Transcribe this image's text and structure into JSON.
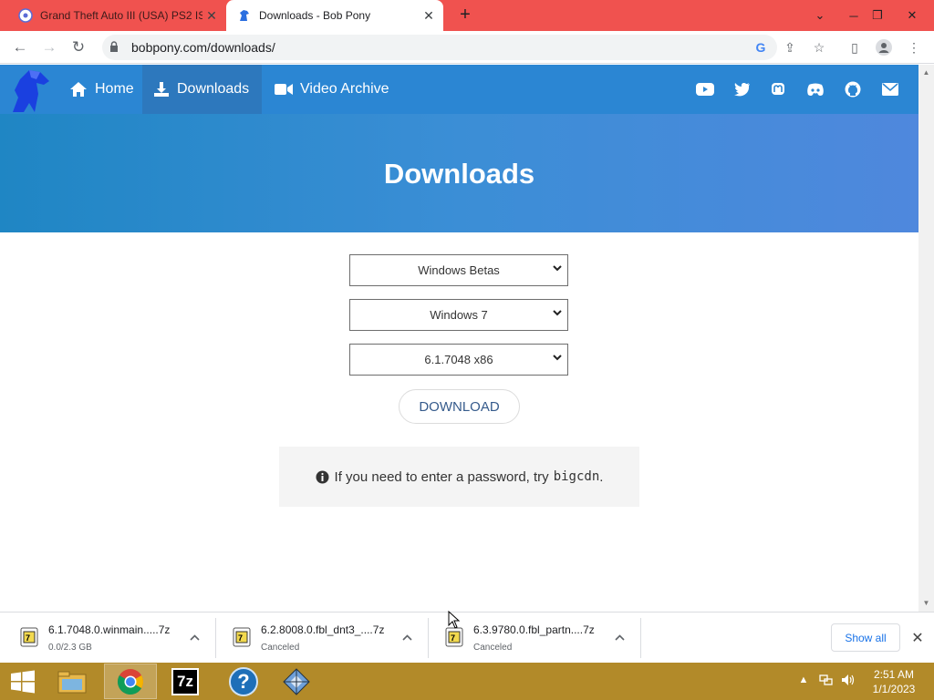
{
  "browser": {
    "tabs": [
      {
        "title": "Grand Theft Auto III (USA) PS2 IS",
        "active": false
      },
      {
        "title": "Downloads - Bob Pony",
        "active": true
      }
    ],
    "new_tab_label": "+",
    "url": "bobpony.com/downloads/"
  },
  "site": {
    "nav": [
      {
        "label": "Home",
        "icon": "home-icon"
      },
      {
        "label": "Downloads",
        "icon": "download-icon",
        "active": true
      },
      {
        "label": "Video Archive",
        "icon": "video-icon"
      }
    ],
    "social": [
      "youtube-icon",
      "twitter-icon",
      "mastodon-icon",
      "discord-icon",
      "github-icon",
      "email-icon"
    ],
    "hero_title": "Downloads",
    "selects": {
      "category": "Windows Betas",
      "os": "Windows 7",
      "build": "6.1.7048 x86"
    },
    "download_button": "DOWNLOAD",
    "notice_text": "If you need to enter a password, try",
    "notice_code": "bigcdn",
    "notice_end": "."
  },
  "downloads_shelf": {
    "items": [
      {
        "name": "6.1.7048.0.winmain.....7z",
        "status": "0.0/2.3 GB"
      },
      {
        "name": "6.2.8008.0.fbl_dnt3_....7z",
        "status": "Canceled"
      },
      {
        "name": "6.3.9780.0.fbl_partn....7z",
        "status": "Canceled"
      }
    ],
    "show_all": "Show all"
  },
  "taskbar": {
    "time": "2:51 AM",
    "date": "1/1/2023",
    "sevenzip_label": "7z",
    "help_label": "?"
  },
  "colors": {
    "tab_strip": "#f0524f",
    "nav_bg": "#2b86d3",
    "taskbar": "#b28a29"
  }
}
